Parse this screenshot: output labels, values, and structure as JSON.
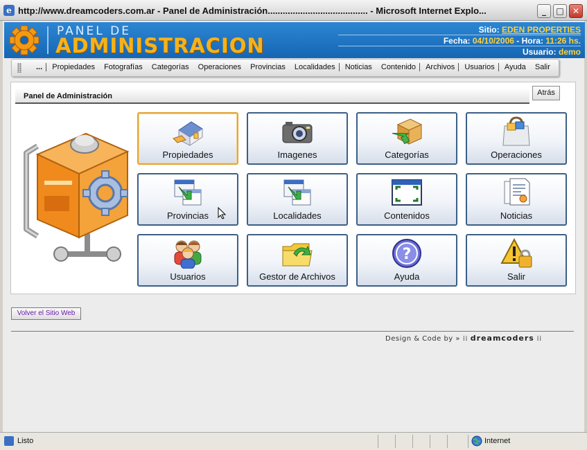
{
  "window": {
    "title": "http://www.dreamcoders.com.ar - Panel de Administración........................................ - Microsoft Internet Explo...",
    "min_label": "_",
    "max_label": "□",
    "close_label": "✕"
  },
  "header": {
    "brand_top": "PANEL DE",
    "brand_main": "ADMINISTRACION",
    "site_label": "Sitio:",
    "site_value": "EDEN PROPERTIES",
    "date_label": "Fecha:",
    "date_value": "04/10/2006",
    "time_label": "- Hora:",
    "time_value": "11:26 hs.",
    "user_label": "Usuario:",
    "user_value": "demo"
  },
  "menu": {
    "dots": "...",
    "items": [
      "Propiedades",
      "Fotografías",
      "Categorías",
      "Operaciones",
      "Provincias",
      "Localidades",
      "Noticias",
      "Contenido",
      "Archivos",
      "Usuarios",
      "Ayuda",
      "Salir"
    ]
  },
  "panel": {
    "title": "Panel de Administración",
    "back_label": "Atrás"
  },
  "tiles": [
    {
      "label": "Propiedades",
      "icon": "house-icon"
    },
    {
      "label": "Imagenes",
      "icon": "camera-icon"
    },
    {
      "label": "Categorías",
      "icon": "box-arrow-icon"
    },
    {
      "label": "Operaciones",
      "icon": "shopping-bag-icon"
    },
    {
      "label": "Provincias",
      "icon": "window-arrow-icon"
    },
    {
      "label": "Localidades",
      "icon": "window-arrow-icon"
    },
    {
      "label": "Contenidos",
      "icon": "screen-frame-icon"
    },
    {
      "label": "Noticias",
      "icon": "document-icon"
    },
    {
      "label": "Usuarios",
      "icon": "users-icon"
    },
    {
      "label": "Gestor de Archivos",
      "icon": "folder-arrow-icon"
    },
    {
      "label": "Ayuda",
      "icon": "help-icon"
    },
    {
      "label": "Salir",
      "icon": "warning-lock-icon"
    }
  ],
  "footer": {
    "site_button": "Volver el Sitio Web",
    "credit_text": "Design & Code by »",
    "credit_brand": "dreamcoders"
  },
  "status": {
    "text": "Listo",
    "zone": "Internet"
  },
  "colors": {
    "header_blue": "#1a72c0",
    "brand_orange": "#f5b21b",
    "tile_border": "#3b5f86",
    "active_tile_border": "#e4a537"
  }
}
